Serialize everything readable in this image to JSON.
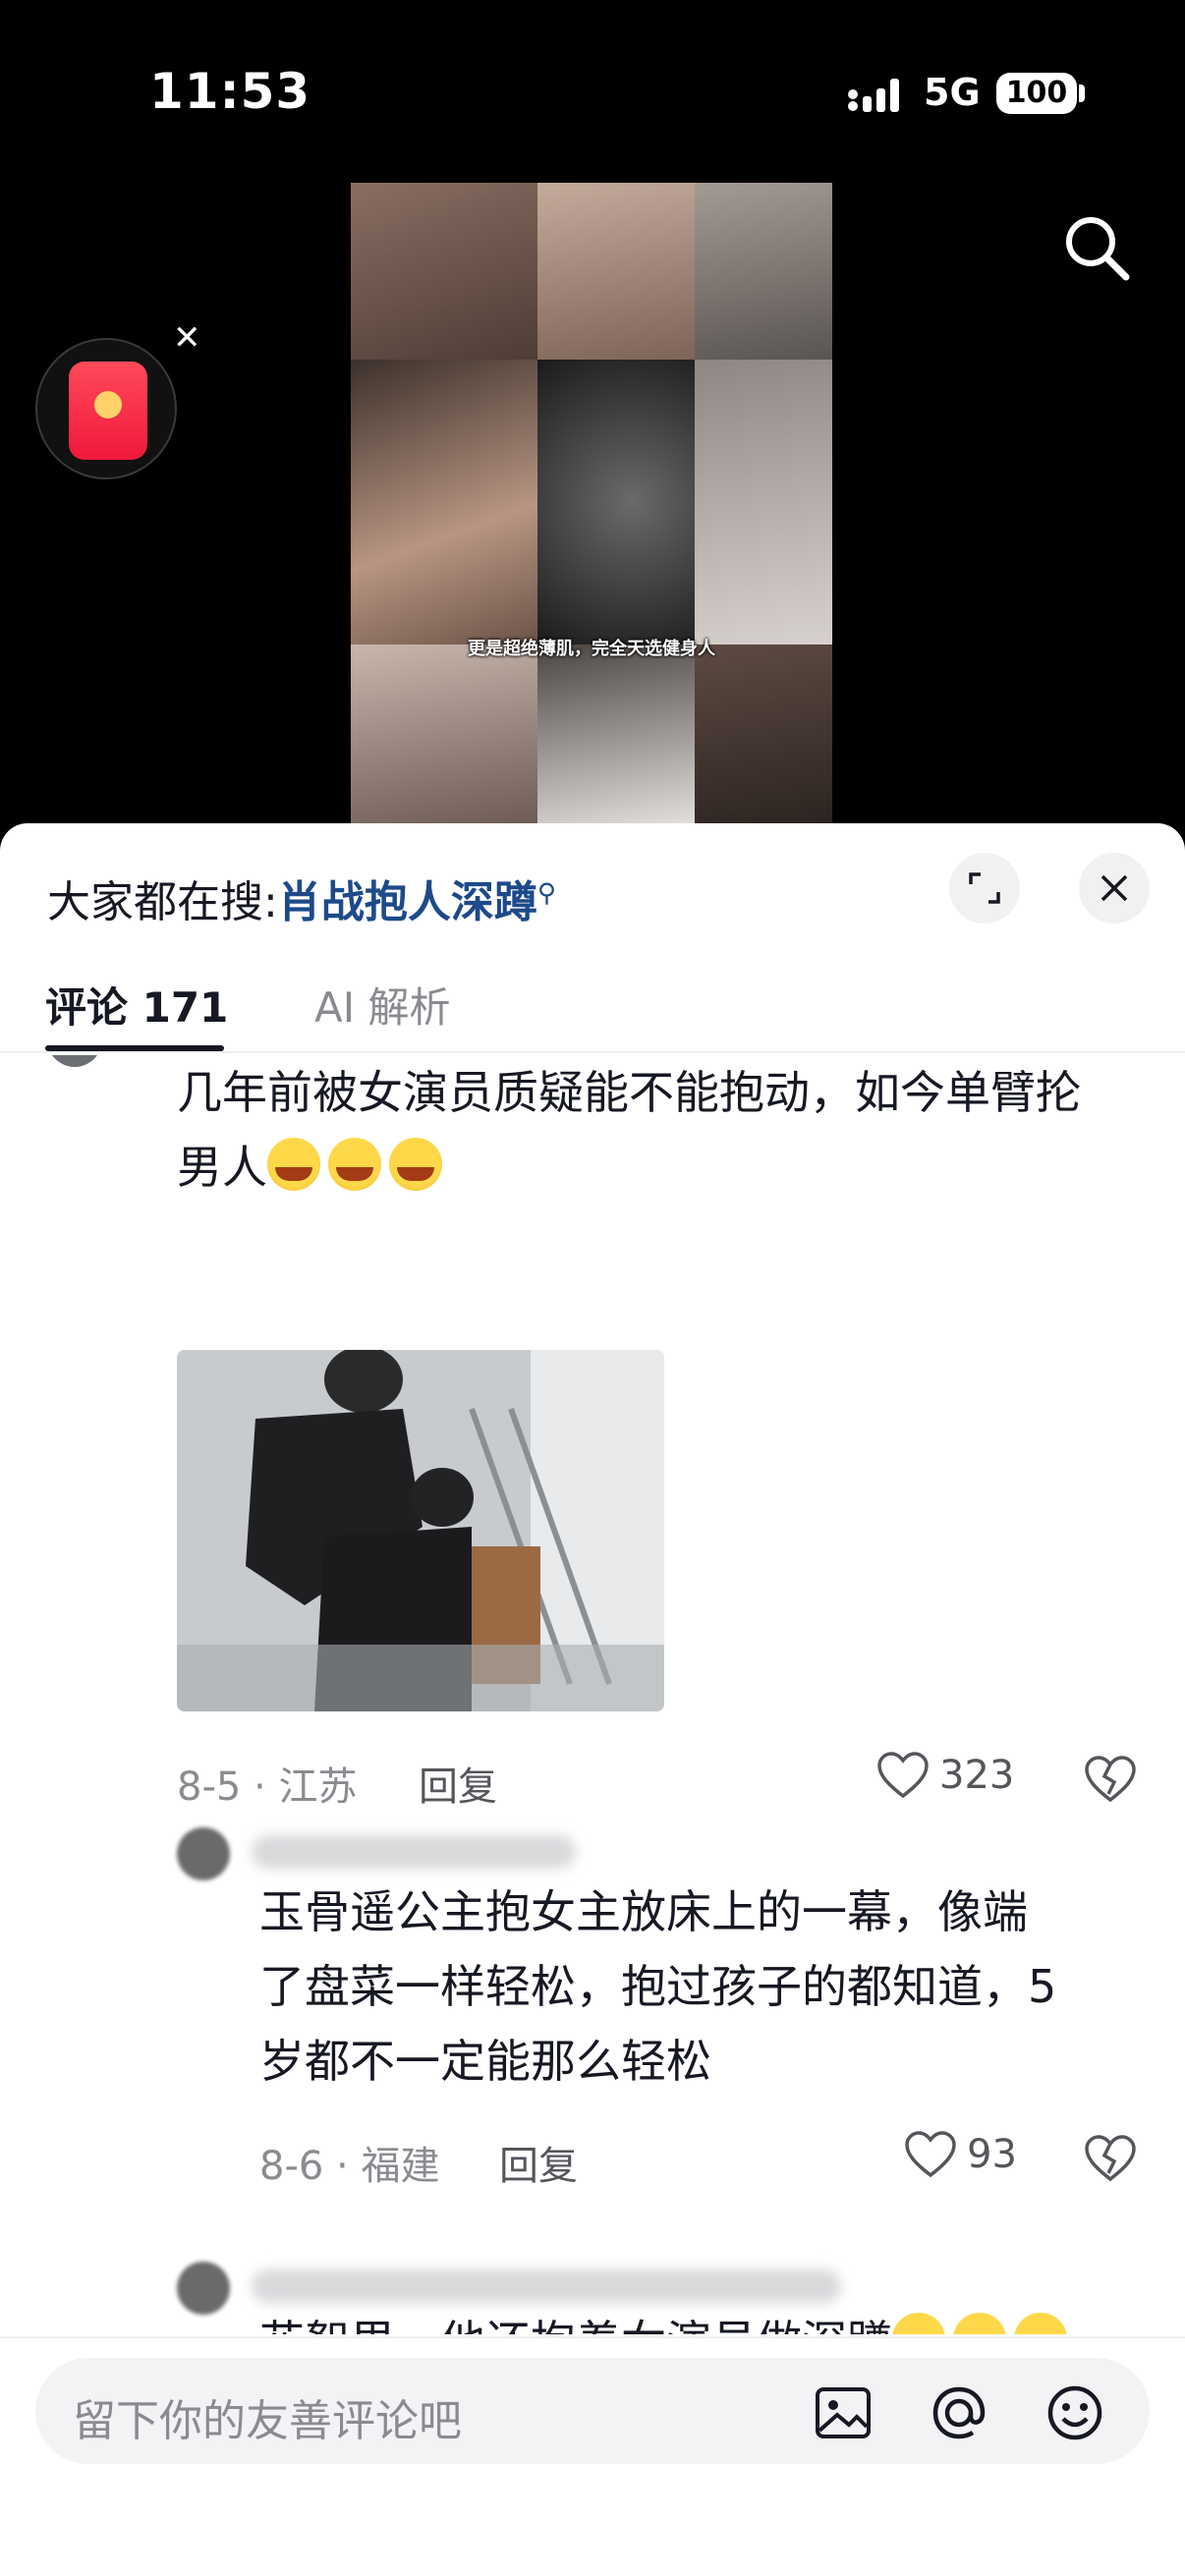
{
  "status_bar": {
    "time": "11:53",
    "network": "5G",
    "battery": "100"
  },
  "video": {
    "caption": "更是超绝薄肌，完全天选健身人"
  },
  "sheet": {
    "search_prefix": "大家都在搜:",
    "search_keyword": "肖战抱人深蹲",
    "tabs": [
      {
        "label": "评论 171"
      },
      {
        "label": "AI 解析"
      }
    ]
  },
  "comments": [
    {
      "text": "几年前被女演员质疑能不能抱动，如今单臂抡男人",
      "meta": "8-5 · 江苏",
      "reply_label": "回复",
      "likes": "323"
    },
    {
      "lines": [
        "玉骨遥公主抱女主放床上的一幕，像端",
        "了盘菜一样轻松，抱过孩子的都知道，5",
        "岁都不一定能那么轻松"
      ],
      "meta": "8-6 · 福建",
      "reply_label": "回复",
      "likes": "93"
    },
    {
      "text": "花絮里，他还抱着女演员做深蹲"
    }
  ],
  "composer": {
    "placeholder": "留下你的友善评论吧"
  },
  "icons": {
    "search": "search-icon",
    "expand": "expand-icon",
    "close": "close-icon",
    "heart": "heart-icon",
    "dislike": "broken-heart-icon",
    "image": "image-icon",
    "mention": "at-icon",
    "emoji": "emoji-icon"
  }
}
